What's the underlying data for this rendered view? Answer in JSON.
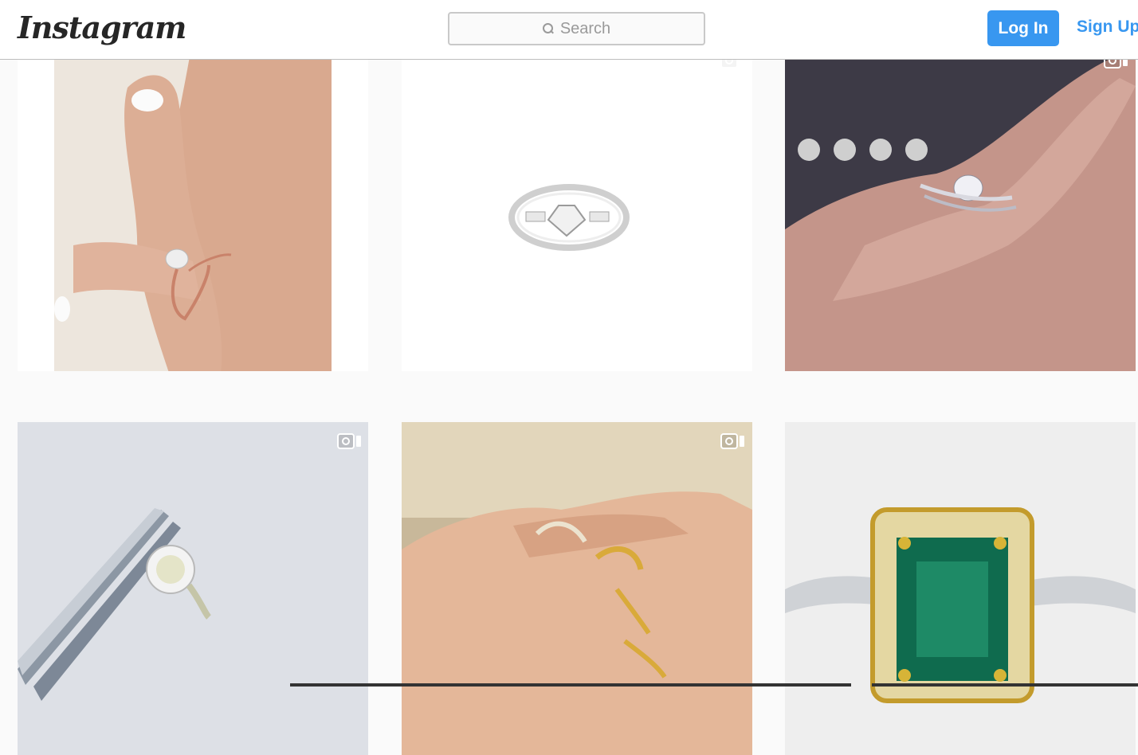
{
  "header": {
    "logo_text": "Instagram",
    "search_placeholder": "Search",
    "login_label": "Log In",
    "signup_label": "Sign Up"
  },
  "colors": {
    "brand_blue": "#3897f0",
    "background": "#fafafa"
  },
  "posts": [
    {
      "subject": "rose gold solitaire engagement ring on hand",
      "has_video_icon": false
    },
    {
      "subject": "white gold ring with round diamond and baguettes",
      "has_video_icon": true
    },
    {
      "subject": "diamond ring with curved band on hand",
      "has_video_icon": true
    },
    {
      "subject": "solitaire diamond ring held by tweezers",
      "has_video_icon": true
    },
    {
      "subject": "stacked gold and diamond contour bands on hand",
      "has_video_icon": true
    },
    {
      "subject": "emerald ring with diamond halo",
      "has_video_icon": false
    }
  ]
}
